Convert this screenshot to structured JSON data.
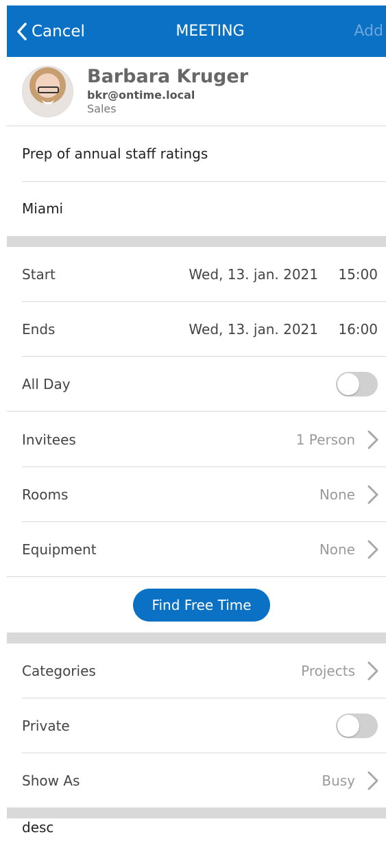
{
  "header": {
    "cancel_label": "Cancel",
    "title": "MEETING",
    "add_label": "Add"
  },
  "profile": {
    "name": "Barbara Kruger",
    "email": "bkr@ontime.local",
    "department": "Sales"
  },
  "subject": "Prep of annual staff ratings",
  "location": "Miami",
  "start": {
    "label": "Start",
    "date": "Wed, 13. jan. 2021",
    "time": "15:00"
  },
  "ends": {
    "label": "Ends",
    "date": "Wed, 13. jan. 2021",
    "time": "16:00"
  },
  "all_day": {
    "label": "All Day",
    "on": false
  },
  "invitees": {
    "label": "Invitees",
    "value": "1 Person"
  },
  "rooms": {
    "label": "Rooms",
    "value": "None"
  },
  "equipment": {
    "label": "Equipment",
    "value": "None"
  },
  "find_free_time_label": "Find Free Time",
  "categories": {
    "label": "Categories",
    "value": "Projects"
  },
  "private": {
    "label": "Private",
    "on": false
  },
  "show_as": {
    "label": "Show As",
    "value": "Busy"
  },
  "description": "desc",
  "colors": {
    "accent": "#0a71c4",
    "toggle_off": "#d0d0d0"
  },
  "icons": {
    "back": "chevron-left-icon",
    "disclosure": "chevron-right-icon"
  }
}
